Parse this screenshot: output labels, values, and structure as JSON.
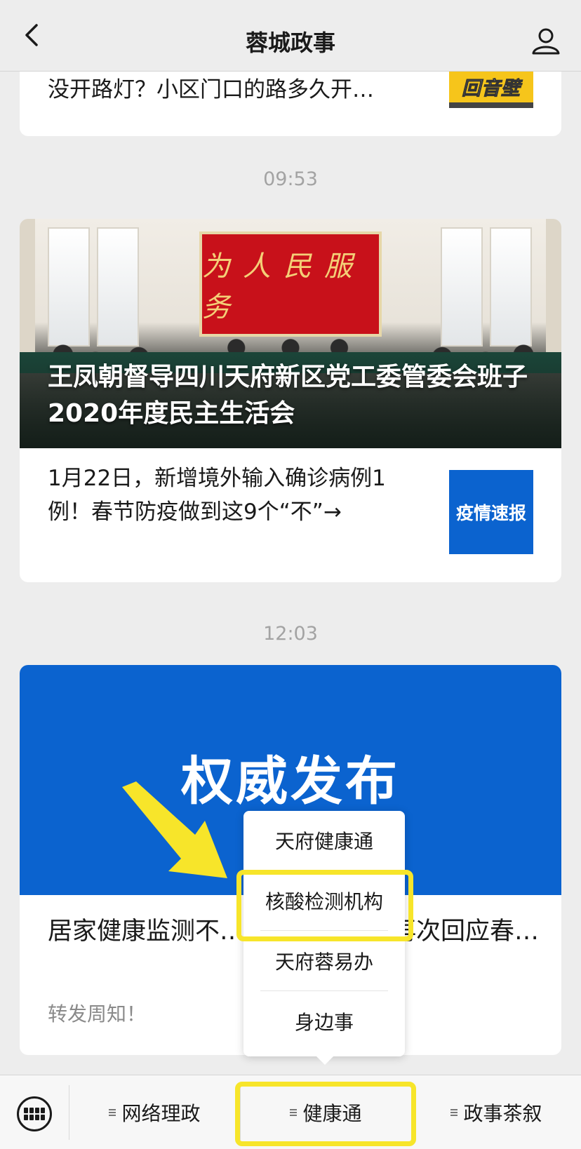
{
  "header": {
    "title": "蓉城政事",
    "back_icon": "chevron-left-icon",
    "profile_icon": "user-icon"
  },
  "card1": {
    "text": "没开路灯？小区门口的路多久开…",
    "thumb_text": "回音壁"
  },
  "timestamp1": "09:53",
  "card2": {
    "banner_text": "为人民服务",
    "headline": "王凤朝督导四川天府新区党工委管委会班子2020年度民主生活会",
    "sub_title": "1月22日，新增境外输入确诊病例1例！春节防疫做到这9个“不”→",
    "thumb_text": "疫情速报"
  },
  "timestamp2": "12:03",
  "card3": {
    "hero_text": "权威发布",
    "title": "居家健康监测不…！国家卫健委再次回应春…",
    "sub": "转发周知！"
  },
  "popup": {
    "items": [
      "天府健康通",
      "核酸检测机构",
      "天府蓉易办",
      "身边事"
    ],
    "highlighted": "核酸检测机构"
  },
  "bottom_menu": {
    "keyboard_icon": "keyboard-icon",
    "items": [
      "网络理政",
      "健康通",
      "政事茶叙"
    ],
    "active": "健康通"
  },
  "colors": {
    "highlight": "#f7e52a",
    "blue": "#0b63cf",
    "red_panel": "#c8111a"
  }
}
